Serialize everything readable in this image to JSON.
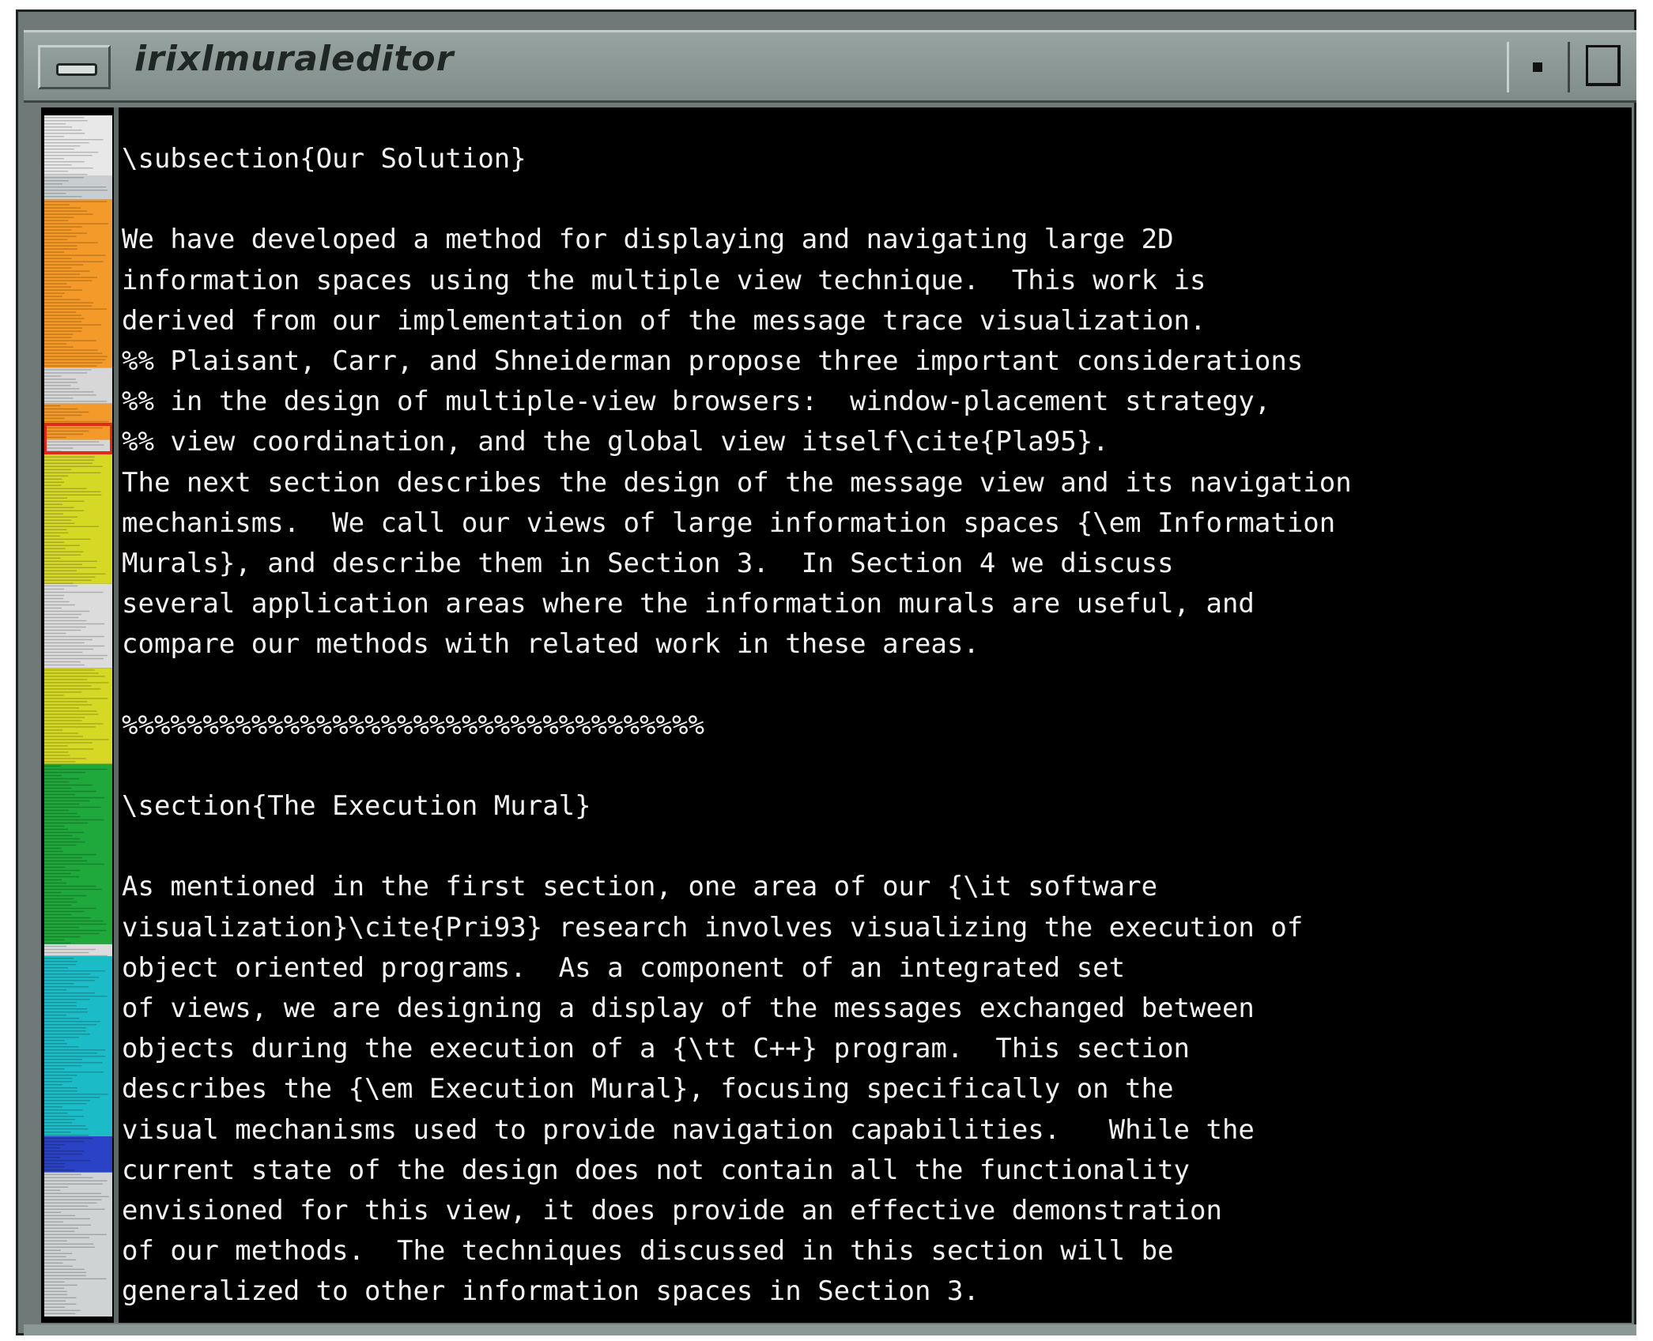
{
  "window": {
    "title": "irixlmuraleditor"
  },
  "mural": {
    "segments": [
      {
        "color": "#e8e8e8",
        "weight": 5
      },
      {
        "color": "#c9cfd0",
        "weight": 2
      },
      {
        "color": "#f39a2b",
        "weight": 14
      },
      {
        "color": "#d7d7d7",
        "weight": 3
      },
      {
        "color": "#f39a2b",
        "weight": 3
      },
      {
        "color": "#d7d7d7",
        "weight": 1
      },
      {
        "color": "#d6d826",
        "weight": 11
      },
      {
        "color": "#dcdcdc",
        "weight": 7
      },
      {
        "color": "#d6d826",
        "weight": 8
      },
      {
        "color": "#1fa83c",
        "weight": 15
      },
      {
        "color": "#dcdcdc",
        "weight": 1
      },
      {
        "color": "#1bbcc7",
        "weight": 15
      },
      {
        "color": "#2a43c6",
        "weight": 3
      },
      {
        "color": "#cfd3d4",
        "weight": 12
      }
    ],
    "viewport_marker_color": "#e02a1a"
  },
  "editor": {
    "lines": [
      "\\subsection{Our Solution}",
      "",
      "We have developed a method for displaying and navigating large 2D",
      "information spaces using the multiple view technique.  This work is",
      "derived from our implementation of the message trace visualization.",
      "%% Plaisant, Carr, and Shneiderman propose three important considerations",
      "%% in the design of multiple-view browsers:  window-placement strategy,",
      "%% view coordination, and the global view itself\\cite{Pla95}.",
      "The next section describes the design of the message view and its navigation",
      "mechanisms.  We call our views of large information spaces {\\em Information",
      "Murals}, and describe them in Section 3.  In Section 4 we discuss",
      "several application areas where the information murals are useful, and",
      "compare our methods with related work in these areas.",
      "",
      "%%%%%%%%%%%%%%%%%%%%%%%%%%%%%%%%%%%%",
      "",
      "\\section{The Execution Mural}",
      "",
      "As mentioned in the first section, one area of our {\\it software",
      "visualization}\\cite{Pri93} research involves visualizing the execution of",
      "object oriented programs.  As a component of an integrated set",
      "of views, we are designing a display of the messages exchanged between",
      "objects during the execution of a {\\tt C++} program.  This section",
      "describes the {\\em Execution Mural}, focusing specifically on the",
      "visual mechanisms used to provide navigation capabilities.   While the",
      "current state of the design does not contain all the functionality",
      "envisioned for this view, it does provide an effective demonstration",
      "of our methods.  The techniques discussed in this section will be",
      "generalized to other information spaces in Section 3."
    ]
  }
}
